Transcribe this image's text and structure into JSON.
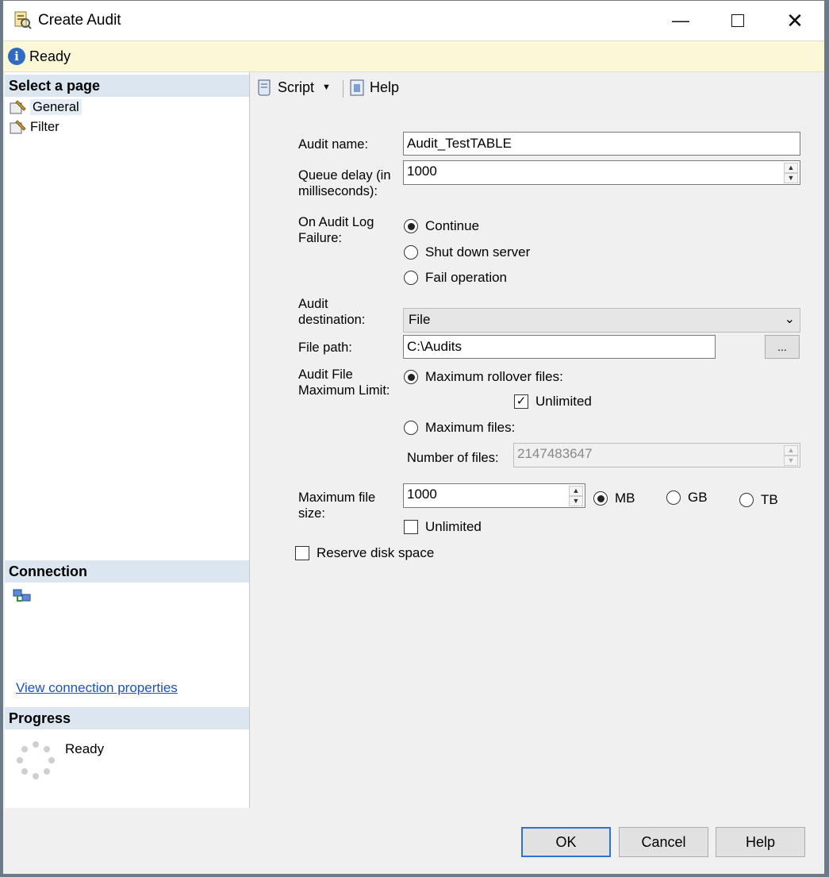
{
  "window": {
    "title": "Create Audit"
  },
  "status": {
    "text": "Ready"
  },
  "left_panel": {
    "select_page_header": "Select a page",
    "pages": [
      {
        "label": "General"
      },
      {
        "label": "Filter"
      }
    ],
    "connection_header": "Connection",
    "view_connection_link": "View connection properties",
    "progress_header": "Progress",
    "progress_status": "Ready"
  },
  "toolbar": {
    "script_label": "Script",
    "help_label": "Help"
  },
  "form": {
    "audit_name_label": "Audit name:",
    "audit_name_value": "Audit_TestTABLE",
    "queue_delay_label_1": "Queue delay (in",
    "queue_delay_label_2": "milliseconds):",
    "queue_delay_value": "1000",
    "failure_label_1": "On Audit Log",
    "failure_label_2": "Failure:",
    "failure_options": [
      "Continue",
      "Shut down server",
      "Fail operation"
    ],
    "failure_selected": "Continue",
    "destination_label_1": "Audit",
    "destination_label_2": "destination:",
    "destination_value": "File",
    "file_path_label": "File path:",
    "file_path_value": "C:\\Audits",
    "browse_label": "...",
    "limit_label_1": "Audit File",
    "limit_label_2": "Maximum Limit:",
    "max_rollover_label": "Maximum rollover files:",
    "rollover_unlimited_label": "Unlimited",
    "rollover_unlimited_checked": true,
    "max_files_label": "Maximum files:",
    "number_of_files_label": "Number of files:",
    "number_of_files_value": "2147483647",
    "max_size_label_1": "Maximum file",
    "max_size_label_2": "size:",
    "max_size_value": "1000",
    "size_units": [
      "MB",
      "GB",
      "TB"
    ],
    "size_unit_selected": "MB",
    "size_unlimited_label": "Unlimited",
    "size_unlimited_checked": false,
    "reserve_disk_label": "Reserve disk space",
    "reserve_disk_checked": false
  },
  "buttons": {
    "ok": "OK",
    "cancel": "Cancel",
    "help": "Help"
  },
  "colors": {
    "status_bg": "#fbf8d8",
    "section_header_bg": "#dce6f0",
    "link": "#1a4fd6",
    "default_button_border": "#2b74d4"
  }
}
